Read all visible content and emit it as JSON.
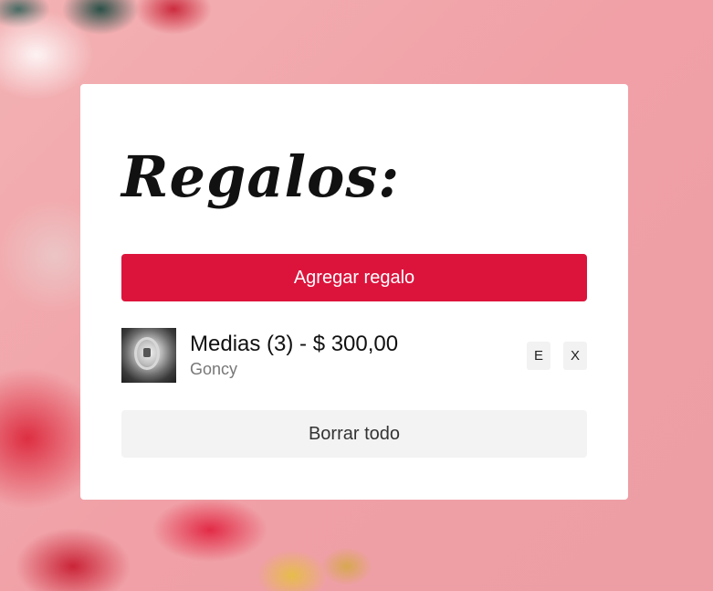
{
  "app": {
    "title": "Regalos:"
  },
  "actions": {
    "add_label": "Agregar regalo",
    "clear_label": "Borrar todo"
  },
  "gifts": [
    {
      "name": "Medias (3) - $ 300,00",
      "recipient": "Goncy",
      "edit_label": "E",
      "delete_label": "X",
      "image": "socks-thumbnail"
    }
  ],
  "colors": {
    "accent": "#dc143c",
    "background": "#f0a5aa",
    "card": "#ffffff",
    "secondary_button": "#f3f3f3"
  }
}
